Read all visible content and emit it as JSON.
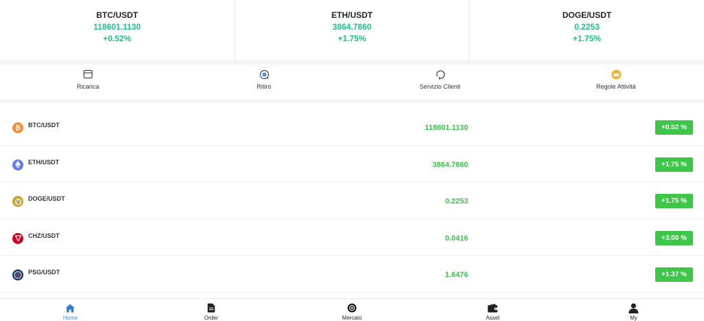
{
  "tickers": [
    {
      "symbol": "BTC/USDT",
      "price": "118601.1130",
      "change": "+0.52%"
    },
    {
      "symbol": "ETH/USDT",
      "price": "3864.7860",
      "change": "+1.75%"
    },
    {
      "symbol": "DOGE/USDT",
      "price": "0.2253",
      "change": "+1.75%"
    }
  ],
  "actions": [
    {
      "label": "Ricarica",
      "icon": "wallet-card-icon"
    },
    {
      "label": "Ritiro",
      "icon": "withdraw-coin-icon"
    },
    {
      "label": "Servizio Clienti",
      "icon": "customer-service-icon"
    },
    {
      "label": "Regole Attività",
      "icon": "crown-icon"
    }
  ],
  "markets": [
    {
      "pair": "BTC/USDT",
      "price": "118601.1130",
      "change": "+0.52 %",
      "icon": "bitcoin-icon",
      "color": "#f09242"
    },
    {
      "pair": "ETH/USDT",
      "price": "3864.7860",
      "change": "+1.75 %",
      "icon": "ethereum-icon",
      "color": "#627eea"
    },
    {
      "pair": "DOGE/USDT",
      "price": "0.2253",
      "change": "+1.75 %",
      "icon": "dogecoin-icon",
      "color": "#c3a634"
    },
    {
      "pair": "CHZ/USDT",
      "price": "0.0416",
      "change": "+3.00 %",
      "icon": "chiliz-icon",
      "color": "#cd0124"
    },
    {
      "pair": "PSG/USDT",
      "price": "1.6476",
      "change": "+1.37 %",
      "icon": "psg-icon",
      "color": "#1d3a6b"
    }
  ],
  "tabs": [
    {
      "label": "Home",
      "icon": "home-icon",
      "active": true
    },
    {
      "label": "Order",
      "icon": "document-icon",
      "active": false
    },
    {
      "label": "Mercato",
      "icon": "market-coin-icon",
      "active": false
    },
    {
      "label": "Asset",
      "icon": "wallet-icon",
      "active": false
    },
    {
      "label": "My",
      "icon": "user-icon",
      "active": false
    }
  ],
  "colors": {
    "up": "#1dbf8c",
    "badge": "#3ec649",
    "active_tab": "#3a8ee6"
  }
}
